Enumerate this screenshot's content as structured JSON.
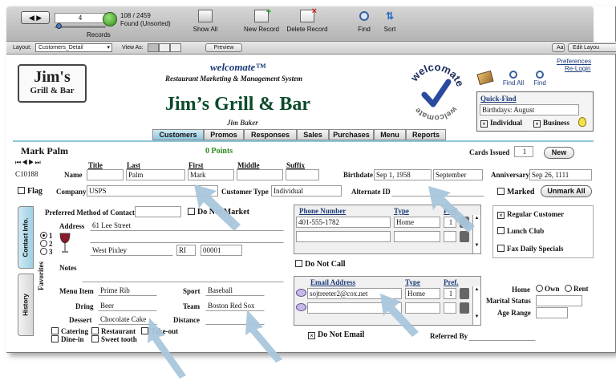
{
  "toolbar": {
    "record_current": "4",
    "record_count": "108 / 2459",
    "found_status": "Found (Unsorted)",
    "records_label": "Records",
    "show_all": "Show All",
    "new_record": "New Record",
    "delete_record": "Delete Record",
    "find": "Find",
    "sort": "Sort"
  },
  "layoutbar": {
    "layout_label": "Layout:",
    "layout_value": "Customers_Detail",
    "view_as_label": "View As:",
    "preview": "Preview",
    "aa": "Aa",
    "edit_layout": "Edit Layou"
  },
  "header": {
    "logo_line1": "Jim's",
    "logo_line2": "Grill & Bar",
    "brand": "welcomate™",
    "tagline": "Restaurant Marketing & Management System",
    "title": "Jim’s Grill & Bar",
    "owner": "Jim Baker",
    "badge_text": "welcomate",
    "preferences": "Preferences",
    "relogin": "Re-Login",
    "find_all": "Find All",
    "find": "Find"
  },
  "quick_find": {
    "title": "Quick-Find",
    "value": "Birthdays:  August",
    "individual": "Individual",
    "business": "Business"
  },
  "tabs": [
    "Customers",
    "Promos",
    "Responses",
    "Sales",
    "Purchases",
    "Menu",
    "Reports"
  ],
  "customer": {
    "name": "Mark  Palm",
    "points": "0  Points",
    "cards_issued_label": "Cards Issued",
    "cards_issued": "1",
    "new_button": "New",
    "id": "C10188",
    "col_title": "Title",
    "col_last": "Last",
    "col_first": "First",
    "col_middle": "Middle",
    "col_suffix": "Suffix",
    "name_label": "Name",
    "title": "",
    "last": "Palm",
    "first": "Mark",
    "middle": "",
    "suffix": "",
    "birthdate_label": "Birthdate",
    "birthdate": "Sep 1, 1958",
    "birth_month": "September",
    "anniversary_label": "Anniversary",
    "anniversary": "Sep 26, 1111",
    "flag": "Flag",
    "company_label": "Company",
    "company": "USPS",
    "customer_type_label": "Customer Type",
    "customer_type": "Individual",
    "alternate_id_label": "Alternate ID",
    "alternate_id": "",
    "marked": "Marked",
    "unmark_all": "Unmark All"
  },
  "contact": {
    "sidetab_contact": "Contact Info.",
    "sidetab_history": "History",
    "preferred_label": "Preferred Method of Contact",
    "preferred": "",
    "do_not_market": "Do Not Market",
    "address_label": "Address",
    "address1": "61 Lee Street",
    "city": "West Pixley",
    "state": "RI",
    "zip": "00001",
    "addr_opts": [
      "1",
      "2",
      "3"
    ],
    "notes_label": "Notes",
    "notes": ""
  },
  "phone": {
    "col_number": "Phone Number",
    "col_type": "Type",
    "col_pref": "Pref.",
    "number": "401-555-1782",
    "type": "Home",
    "pref": "1",
    "do_not_call": "Do Not Call"
  },
  "email": {
    "col_address": "Email Address",
    "col_type": "Type",
    "col_pref": "Pref.",
    "address": "sojtreeter2@cox.net",
    "type": "Home",
    "pref": "1",
    "do_not_email": "Do Not Email",
    "referred_by_label": "Referred By",
    "referred_by": ""
  },
  "favorites": {
    "section": "Favorites",
    "menu_item_label": "Menu Item",
    "menu_item": "Prime Rib",
    "drink_label": "Dring",
    "drink": "Beer",
    "dessert_label": "Dessert",
    "dessert": "Chocolate Cake",
    "sport_label": "Sport",
    "sport": "Baseball",
    "team_label": "Team",
    "team": "Boston Red Sox",
    "distance_label": "Distance",
    "distance": "",
    "catering": "Catering",
    "restaurant": "Restaurant",
    "takeout": "Take-out",
    "dinein": "Dine-in",
    "sweet_tooth": "Sweet tooth"
  },
  "options": {
    "regular_customer": "Regular Customer",
    "lunch_club": "Lunch Club",
    "fax_daily": "Fax Daily Specials",
    "home_label": "Home",
    "own": "Own",
    "rent": "Rent",
    "marital_label": "Marital Status",
    "marital": "",
    "age_label": "Age Range",
    "age": ""
  },
  "colors": {
    "accent_tab": "#8fc7dd",
    "arrow": "#a9c6dc",
    "title_green": "#0b4a2a",
    "points_green": "#2d8a1e"
  }
}
